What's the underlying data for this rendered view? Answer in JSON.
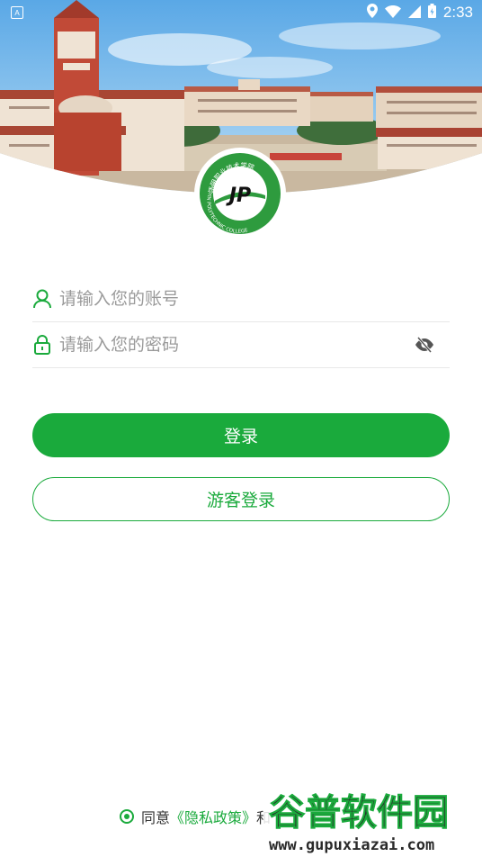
{
  "status_bar": {
    "time": "2:33",
    "notification_glyph": "A",
    "icons": [
      "location-icon",
      "wifi-icon",
      "signal-icon",
      "battery-icon"
    ]
  },
  "logo": {
    "arc_text_top": "江阴职业技术学院",
    "arc_text_side": "JIANGYIN POLYTECHNIC COLLEGE",
    "monogram": "JP"
  },
  "login_form": {
    "account_placeholder": "请输入您的账号",
    "password_placeholder": "请输入您的密码"
  },
  "buttons": {
    "login_label": "登录",
    "guest_label": "游客登录"
  },
  "agreement": {
    "prefix": "同意",
    "policy_link": "《隐私政策》",
    "suffix_visible": "和"
  },
  "watermark": {
    "brand": "谷普软件园",
    "url": "www.gupuxiazai.com"
  },
  "colors": {
    "accent": "#1aaa3c",
    "logo_green": "#2e9b3e"
  }
}
